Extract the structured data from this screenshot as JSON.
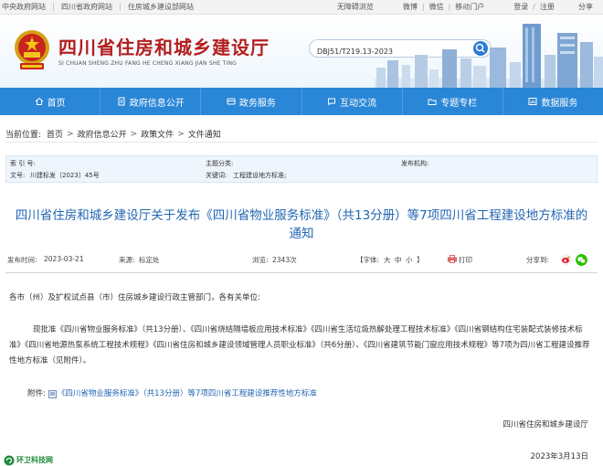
{
  "topbar": {
    "left_links": [
      "中央政府网站",
      "四川省政府网站",
      "住房城乡建设部网站"
    ],
    "accessibility": "无障碍浏览",
    "social": [
      "微博",
      "微信",
      "移动门户"
    ],
    "login": "登录",
    "register": "注册",
    "share": "分享"
  },
  "header": {
    "title": "四川省住房和城乡建设厅",
    "pinyin": "SI CHUAN SHENG ZHU FANG HE CHENG XIANG JIAN SHE TING",
    "search_value": "DBJ51/T219.13-2023"
  },
  "nav": {
    "items": [
      {
        "label": "首页",
        "icon": "home-icon"
      },
      {
        "label": "政府信息公开",
        "icon": "document-icon"
      },
      {
        "label": "政务服务",
        "icon": "service-icon"
      },
      {
        "label": "互动交流",
        "icon": "chat-icon"
      },
      {
        "label": "专题专栏",
        "icon": "folder-icon"
      },
      {
        "label": "数据服务",
        "icon": "data-icon"
      }
    ]
  },
  "breadcrumb": {
    "label": "当前位置:",
    "items": [
      "首页",
      "政府信息公开",
      "政策文件",
      "文件通知"
    ]
  },
  "meta": {
    "index_label": "索 引 号:",
    "index_value": "",
    "topic_label": "主题分类:",
    "topic_value": "",
    "org_label": "发布机构:",
    "org_value": "",
    "docno_label": "文号:",
    "docno_value": "川建标发〔2023〕45号",
    "keywords_label": "关键词:",
    "keywords_value": "工程建设地方标准;"
  },
  "article": {
    "title": "四川省住房和城乡建设厅关于发布《四川省物业服务标准》（共13分册）等7项四川省工程建设地方标准的通知",
    "date_label": "发布时间:",
    "date_value": "2023-03-21",
    "source_label": "来源:",
    "source_value": "标定处",
    "views_label": "浏览:",
    "views_value": "2343次",
    "font_label": "【字体:",
    "font_sizes": [
      "大",
      "中",
      "小"
    ],
    "font_close": "】",
    "print_label": "打印",
    "share_label": "分享到:",
    "salutation": "各市（州）及扩权试点县（市）住房城乡建设行政主管部门，各有关单位:",
    "paragraph": "现批准《四川省物业服务标准》（共13分册）、《四川省烧结隔墙板应用技术标准》《四川省生活垃圾热解处理工程技术标准》《四川省钢结构住宅装配式装修技术标准》《四川省地源热泵系统工程技术规程》《四川省住房和城乡建设领域管理人员职业标准》（共6分册）、《四川省建筑节能门窗应用技术规程》等7项为四川省工程建设推荐性地方标准（见附件）。",
    "attachment_label": "附件:",
    "attachment_link": "《四川省物业服务标准》（共13分册）等7项四川省工程建设推荐性地方标准",
    "signature": "四川省住房和城乡建设厅",
    "sign_date": "2023年3月13日"
  },
  "footer": {
    "logo_text": "环卫科技网"
  },
  "colors": {
    "nav_blue": "#2a86d6",
    "title_red": "#b41e1e",
    "link_blue": "#2366b3"
  }
}
